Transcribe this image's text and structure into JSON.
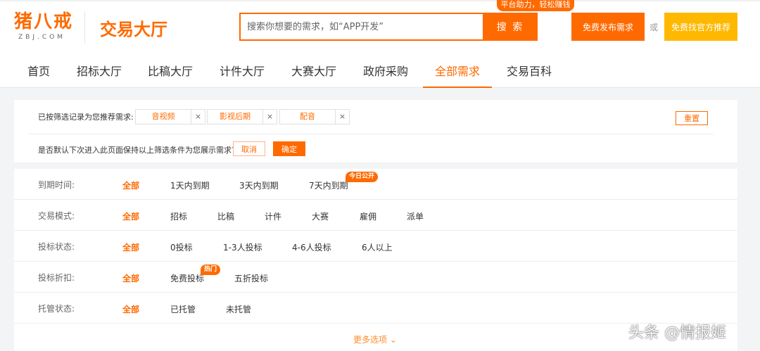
{
  "header": {
    "logo_cn": "猪八戒",
    "logo_en": "ZBJ.COM",
    "hall_title": "交易大厅",
    "search_placeholder": "搜索你想要的需求，如“APP开发”",
    "search_button": "搜 索",
    "promo_tag": "平台助力，轻松赚钱",
    "post_button": "免费发布需求",
    "or_text": "或",
    "official_button": "免费找官方推荐"
  },
  "nav": {
    "items": [
      {
        "label": "首页"
      },
      {
        "label": "招标大厅"
      },
      {
        "label": "比稿大厅"
      },
      {
        "label": "计件大厅"
      },
      {
        "label": "大赛大厅"
      },
      {
        "label": "政府采购"
      },
      {
        "label": "全部需求",
        "active": true
      },
      {
        "label": "交易百科"
      }
    ]
  },
  "notice": {
    "label": "已按筛选记录为您推荐需求:",
    "chips": [
      {
        "label": "音视频"
      },
      {
        "label": "影视后期"
      },
      {
        "label": "配音"
      }
    ],
    "chip_close": "×",
    "reset_button": "重置",
    "confirm_text": "是否默认下次进入此页面保持以上筛选条件为您展示需求?",
    "cancel_button": "取消",
    "ok_button": "确定"
  },
  "filters": {
    "rows": [
      {
        "label": "到期时间:",
        "options": [
          "全部",
          "1天内到期",
          "3天内到期",
          "7天内到期"
        ],
        "badge": "今日公开"
      },
      {
        "label": "交易模式:",
        "options": [
          "全部",
          "招标",
          "比稿",
          "计件",
          "大赛",
          "雇佣",
          "派单"
        ]
      },
      {
        "label": "投标状态:",
        "options": [
          "全部",
          "0投标",
          "1-3人投标",
          "4-6人投标",
          "6人以上"
        ]
      },
      {
        "label": "投标折扣:",
        "options": [
          "全部",
          "免费投标",
          "五折投标"
        ],
        "badge": "热门"
      },
      {
        "label": "托管状态:",
        "options": [
          "全部",
          "已托管",
          "未托管"
        ]
      }
    ],
    "more": "更多选项 ⌄"
  },
  "watermark": "头条 @情报姬",
  "colors": {
    "accent": "#ff6a00",
    "accent_yellow": "#ffb800"
  }
}
